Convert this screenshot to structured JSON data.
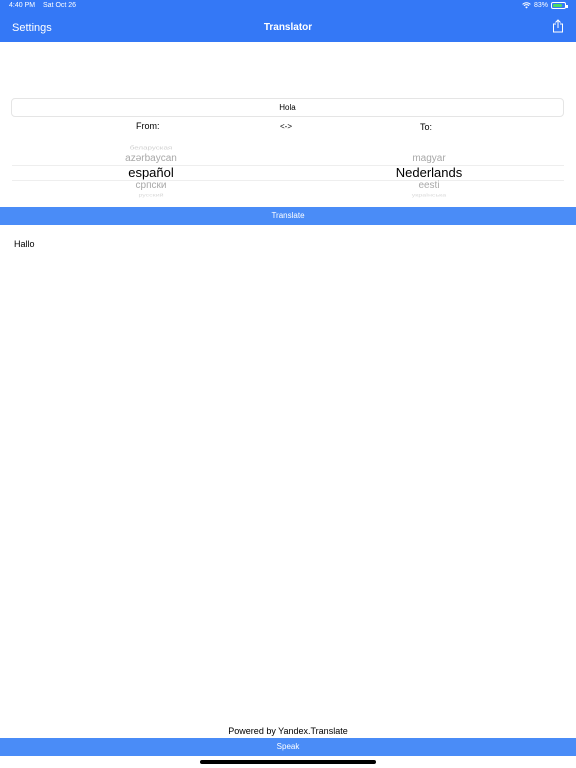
{
  "status_bar": {
    "time": "4:40 PM",
    "date": "Sat Oct 26",
    "battery": "83%",
    "battery_level": 0.83
  },
  "nav": {
    "settings_label": "Settings",
    "title": "Translator",
    "share_icon": "share-icon"
  },
  "input": {
    "value": "Hola"
  },
  "labels": {
    "from": "From:",
    "swap": "<->",
    "to": "To:"
  },
  "from_picker": {
    "items": [
      "беларуская",
      "azərbaycan",
      "español",
      "српски",
      "русский"
    ],
    "selected": "español"
  },
  "to_picker": {
    "items": [
      "",
      "magyar",
      "Nederlands",
      "eesti",
      "українська"
    ],
    "selected": "Nederlands"
  },
  "buttons": {
    "translate": "Translate",
    "speak": "Speak"
  },
  "output": {
    "text": "Hallo"
  },
  "footer": {
    "powered_by": "Powered by Yandex.Translate"
  },
  "colors": {
    "accent": "#3478f6",
    "button": "#4a8cf7"
  }
}
